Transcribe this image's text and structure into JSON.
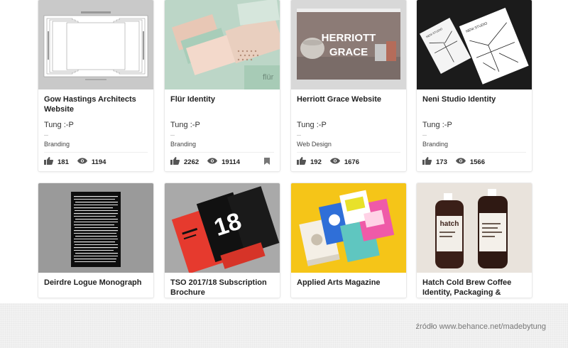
{
  "cards": [
    {
      "title": "Gow Hastings Architects Website",
      "owner": "Tung :-P",
      "field": "Branding",
      "likes": "181",
      "views": "1194"
    },
    {
      "title": "Flür Identity",
      "owner": "Tung :-P",
      "field": "Branding",
      "likes": "2262",
      "views": "19114",
      "thumb_text": "flür"
    },
    {
      "title": "Herriott Grace Website",
      "owner": "Tung :-P",
      "field": "Web Design",
      "likes": "192",
      "views": "1676",
      "thumb_text_1": "HERRIOTT",
      "thumb_text_2": "GRACE"
    },
    {
      "title": "Neni Studio Identity",
      "owner": "Tung :-P",
      "field": "Branding",
      "likes": "173",
      "views": "1566",
      "thumb_text": "NENI STUDIO"
    },
    {
      "title": "Deirdre Logue Monograph"
    },
    {
      "title": "TSO 2017/18 Subscription Brochure"
    },
    {
      "title": "Applied Arts Magazine"
    },
    {
      "title": "Hatch Cold Brew Coffee Identity, Packaging & Website",
      "thumb_text": "hatch"
    }
  ],
  "footer": {
    "source": "źródło www.behance.net/madebytung"
  },
  "icons": {
    "like": "thumbs-up-icon",
    "view": "eye-icon",
    "bookmark": "bookmark-icon"
  },
  "colors": {
    "yellow_bg": "#f5c518",
    "dark_bg": "#1b1b1b",
    "mint": "#b8d4c4"
  }
}
